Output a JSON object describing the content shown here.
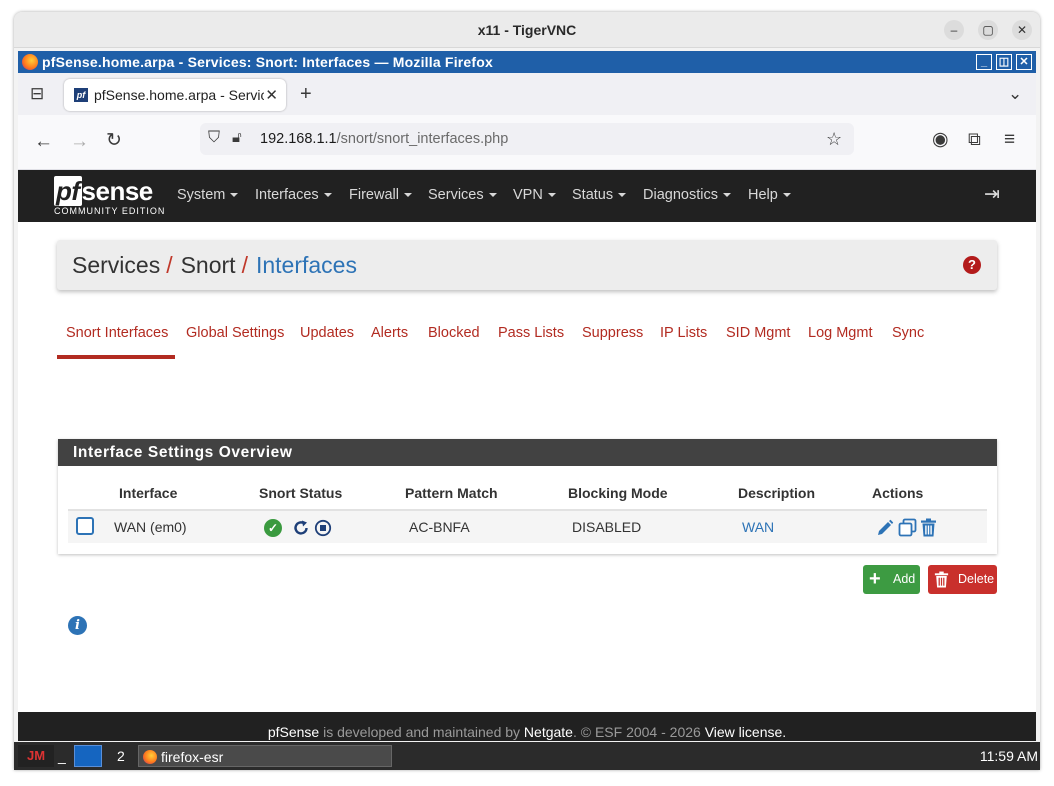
{
  "vnc": {
    "title": "x11 - TigerVNC"
  },
  "firefox": {
    "window_title": "pfSense.home.arpa - Services: Snort: Interfaces — Mozilla Firefox",
    "tab_title": "pfSense.home.arpa - Services: Snort: Interfaces",
    "url_host": "192.168.1.1",
    "url_path": "/snort/snort_interfaces.php"
  },
  "pfsense": {
    "logo_main": "sense",
    "logo_pf": "pf",
    "logo_sub": "COMMUNITY EDITION",
    "menu": [
      "System",
      "Interfaces",
      "Firewall",
      "Services",
      "VPN",
      "Status",
      "Diagnostics",
      "Help"
    ],
    "breadcrumb": [
      "Services",
      "Snort",
      "Interfaces"
    ],
    "subtabs": [
      "Snort Interfaces",
      "Global Settings",
      "Updates",
      "Alerts",
      "Blocked",
      "Pass Lists",
      "Suppress",
      "IP Lists",
      "SID Mgmt",
      "Log Mgmt",
      "Sync"
    ],
    "active_subtab": "Snort Interfaces",
    "panel_title": "Interface Settings Overview",
    "columns": [
      "Interface",
      "Snort Status",
      "Pattern Match",
      "Blocking Mode",
      "Description",
      "Actions"
    ],
    "rows": [
      {
        "interface": "WAN (em0)",
        "pattern_match": "AC-BNFA",
        "blocking_mode": "DISABLED",
        "description": "WAN"
      }
    ],
    "add_label": "Add",
    "delete_label": "Delete",
    "footer": {
      "brand": "pfSense",
      "mid": " is developed and maintained by ",
      "company": "Netgate",
      "copy": ". © ESF 2004 - 2026 ",
      "license": "View license."
    }
  },
  "taskbar": {
    "workspace": "2",
    "app": "firefox-esr",
    "clock": "11:59 AM"
  },
  "colors": {
    "accent_red": "#b22b21",
    "link_blue": "#2d73b6",
    "nav_dark": "#212121",
    "success_green": "#3a9a3f",
    "delete_red": "#c9302c"
  }
}
